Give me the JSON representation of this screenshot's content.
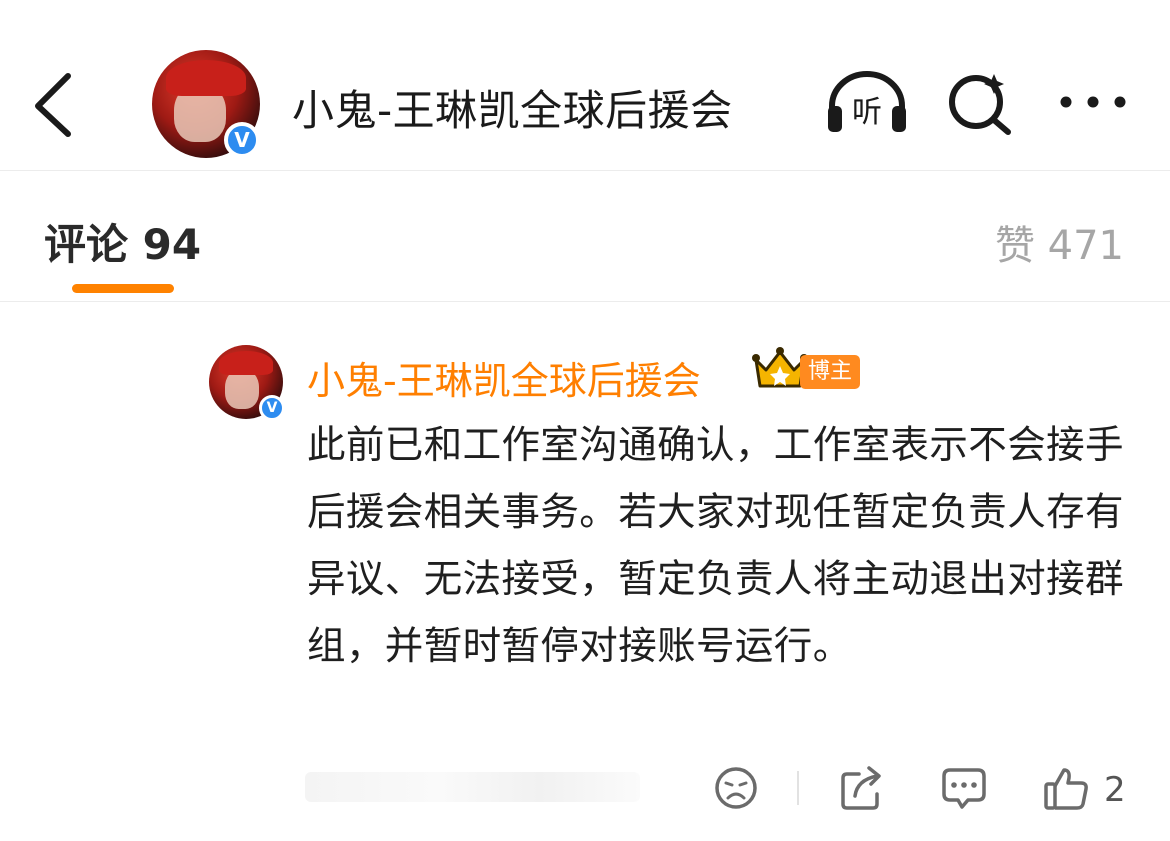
{
  "header": {
    "title": "小鬼-王琳凯全球后援会",
    "listen_label": "听",
    "verify_mark": "V"
  },
  "tabs": {
    "comments_label": "评论 94",
    "likes_label": "赞 471"
  },
  "comment": {
    "author": "小鬼-王琳凯全球后援会",
    "badge": "博主",
    "verify_mark": "V",
    "text": "此前已和工作室沟通确认，工作室表示不会接手后援会相关事务。若大家对现任暂定负责人存有异议、无法接受，暂定负责人将主动退出对接群组，并暂时暂停对接账号运行。",
    "like_count": "2"
  },
  "colors": {
    "accent": "#ff8200",
    "author": "#ff7f00",
    "verified": "#2d8cf0"
  },
  "icons": [
    "back-icon",
    "listen-icon",
    "search-icon",
    "more-icon",
    "crown-icon",
    "emoji-icon",
    "share-icon",
    "comment-icon",
    "like-icon"
  ]
}
